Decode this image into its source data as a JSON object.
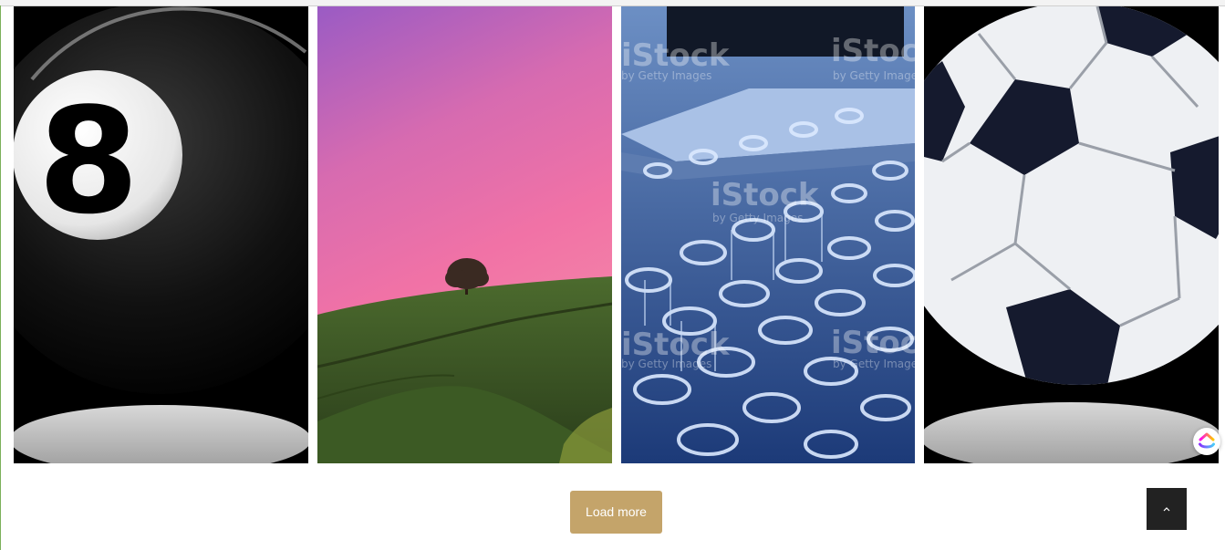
{
  "gallery": {
    "tiles": [
      {
        "icon": "eight-ball-image"
      },
      {
        "icon": "tree-on-hill-image"
      },
      {
        "icon": "test-tubes-image",
        "watermark_text": "iStock",
        "watermark_sub": "by Getty Images"
      },
      {
        "icon": "soccer-ball-image"
      }
    ]
  },
  "actions": {
    "load_more_label": "Load more"
  },
  "widgets": {
    "scroll_top_icon": "chevron-up-icon",
    "helper_icon": "clickup-logo-icon"
  },
  "colors": {
    "load_more_bg": "#c4a46a",
    "scroll_top_bg": "#222222"
  }
}
